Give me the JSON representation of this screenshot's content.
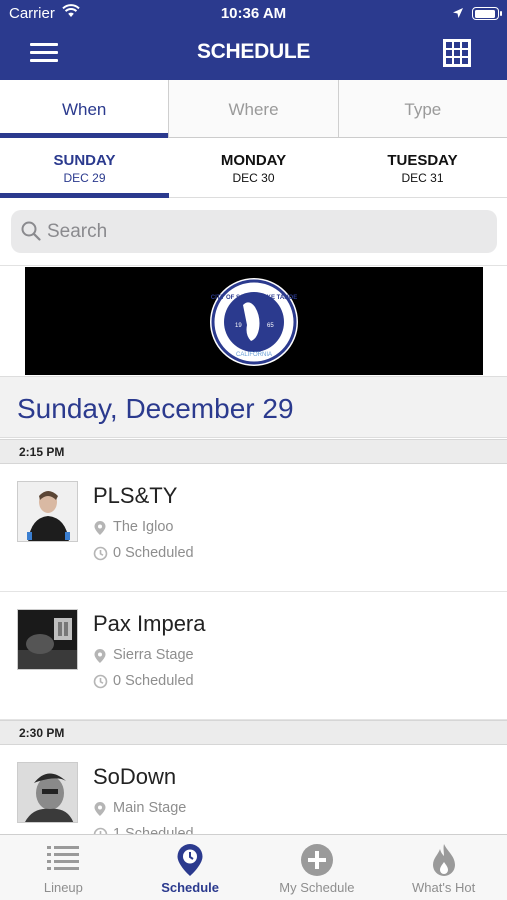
{
  "status_bar": {
    "carrier": "Carrier",
    "time": "10:36 AM",
    "battery_level": 0.95
  },
  "header": {
    "title": "SCHEDULE",
    "menu_icon": "hamburger-icon",
    "grid_icon": "grid-icon"
  },
  "segment_tabs": [
    {
      "label": "When",
      "active": true
    },
    {
      "label": "Where",
      "active": false
    },
    {
      "label": "Type",
      "active": false
    }
  ],
  "days": [
    {
      "name": "SUNDAY",
      "date": "DEC 29",
      "active": true
    },
    {
      "name": "MONDAY",
      "date": "DEC 30",
      "active": false
    },
    {
      "name": "TUESDAY",
      "date": "DEC 31",
      "active": false
    }
  ],
  "search": {
    "placeholder": "Search"
  },
  "banner": {
    "seal_text_top": "CITY OF SOUTH LAKE TAHOE",
    "seal_text_bottom": "CALIFORNIA",
    "seal_year_left": "19",
    "seal_year_right": "65"
  },
  "day_title": "Sunday, December 29",
  "time_groups": [
    {
      "time": "2:15 PM",
      "events": [
        {
          "name": "PLS&TY",
          "venue": "The Igloo",
          "scheduled": "0 Scheduled"
        },
        {
          "name": "Pax Impera",
          "venue": "Sierra Stage",
          "scheduled": "0 Scheduled"
        }
      ]
    },
    {
      "time": "2:30 PM",
      "events": [
        {
          "name": "SoDown",
          "venue": "Main Stage",
          "scheduled": "1 Scheduled"
        }
      ]
    }
  ],
  "tab_bar": [
    {
      "label": "Lineup",
      "icon": "list-icon",
      "active": false
    },
    {
      "label": "Schedule",
      "icon": "location-pin-icon",
      "active": true
    },
    {
      "label": "My Schedule",
      "icon": "plus-circle-icon",
      "active": false
    },
    {
      "label": "What's Hot",
      "icon": "flame-icon",
      "active": false
    }
  ],
  "colors": {
    "primary": "#2b3a8e",
    "muted": "#8e8e8e",
    "background": "#ffffff"
  }
}
